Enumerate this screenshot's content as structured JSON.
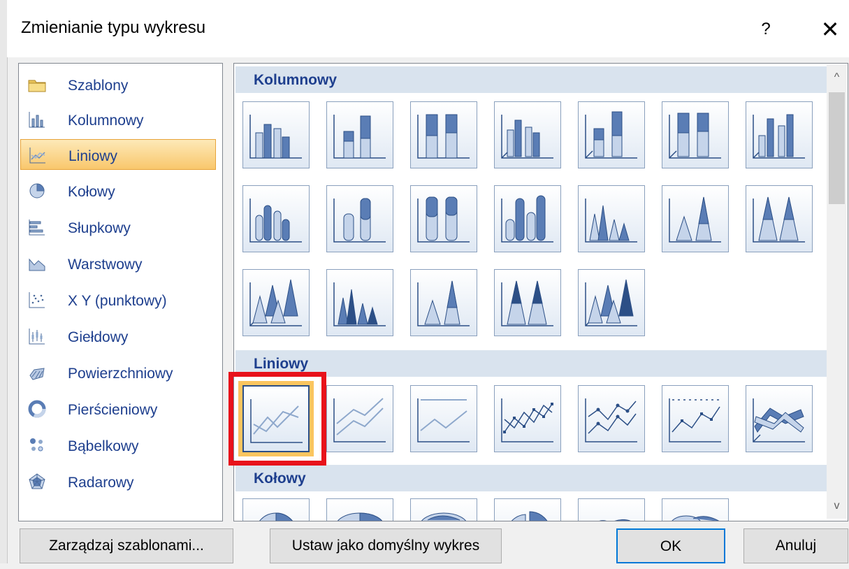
{
  "window": {
    "title": "Zmienianie typu wykresu",
    "help_label": "?",
    "close_label": "✕"
  },
  "chart_types": [
    {
      "label": "Szablony",
      "icon": "folder-icon"
    },
    {
      "label": "Kolumnowy",
      "icon": "column-chart-icon"
    },
    {
      "label": "Liniowy",
      "icon": "line-chart-icon",
      "selected": true
    },
    {
      "label": "Kołowy",
      "icon": "pie-chart-icon"
    },
    {
      "label": "Słupkowy",
      "icon": "bar-chart-icon"
    },
    {
      "label": "Warstwowy",
      "icon": "area-chart-icon"
    },
    {
      "label": "X Y (punktowy)",
      "icon": "scatter-chart-icon"
    },
    {
      "label": "Giełdowy",
      "icon": "stock-chart-icon"
    },
    {
      "label": "Powierzchniowy",
      "icon": "surface-chart-icon"
    },
    {
      "label": "Pierścieniowy",
      "icon": "doughnut-chart-icon"
    },
    {
      "label": "Bąbelkowy",
      "icon": "bubble-chart-icon"
    },
    {
      "label": "Radarowy",
      "icon": "radar-chart-icon"
    }
  ],
  "gallery": {
    "sections": [
      {
        "title": "Kolumnowy"
      },
      {
        "title": "Liniowy"
      },
      {
        "title": "Kołowy"
      }
    ]
  },
  "buttons": {
    "manage_templates": "Zarządzaj szablonami...",
    "set_default": "Ustaw jako domyślny wykres",
    "ok": "OK",
    "cancel": "Anuluj"
  },
  "colors": {
    "accent": "#1e3f8e",
    "selection": "#f9c76c",
    "highlight": "#e8121b",
    "section_bg": "#d9e3ee"
  },
  "scrollbar": {
    "up_arrow": "^",
    "down_arrow": "v"
  }
}
